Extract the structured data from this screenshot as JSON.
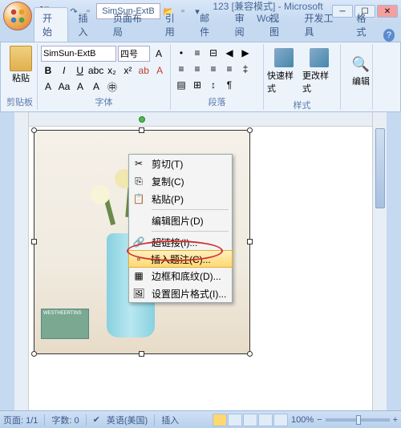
{
  "title": "123 [兼容模式] - Microsoft Wo...",
  "qat_font": "SimSun-ExtB",
  "tabs": {
    "t0": "开始",
    "t1": "插入",
    "t2": "页面布局",
    "t3": "引用",
    "t4": "邮件",
    "t5": "审阅",
    "t6": "视图",
    "t7": "开发工具",
    "t8": "格式"
  },
  "ribbon": {
    "clipboard": {
      "paste": "粘贴",
      "label": "剪贴板"
    },
    "font": {
      "name": "SimSun-ExtB",
      "size": "四号",
      "label": "字体"
    },
    "paragraph": {
      "label": "段落"
    },
    "styles": {
      "quick": "快速样式",
      "change": "更改样式",
      "label": "样式"
    },
    "editing": {
      "label": "编辑"
    }
  },
  "context_menu": {
    "cut": "剪切(T)",
    "copy": "复制(C)",
    "paste": "粘贴(P)",
    "edit_pic": "编辑图片(D)",
    "hyperlink": "超链接(I)...",
    "insert_caption": "插入题注(C)...",
    "border_shading": "边框和底纹(D)...",
    "format_pic": "设置图片格式(I)..."
  },
  "picture": {
    "book_text": "WESTHEERTINS"
  },
  "statusbar": {
    "page": "页面: 1/1",
    "words": "字数: 0",
    "lang": "英语(美国)",
    "mode": "插入",
    "zoom": "100%"
  }
}
